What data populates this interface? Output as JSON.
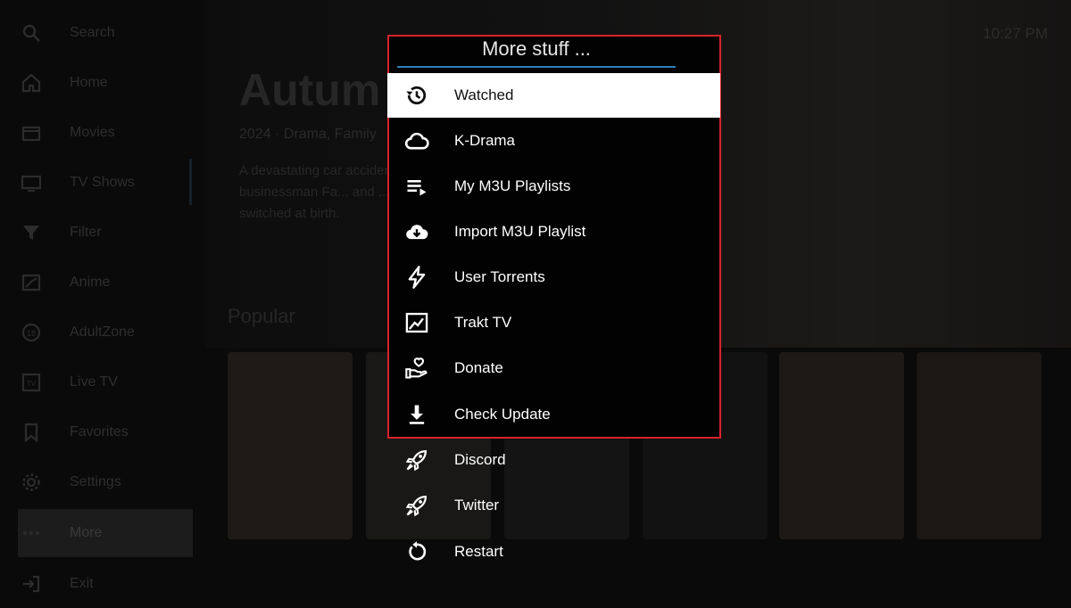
{
  "background": {
    "clock": "10:27 PM",
    "hero": {
      "title": "Autum",
      "meta": "2024 · Drama, Family",
      "description": "A devastating car accident unearths a long-buried secret that turns wealthy businessman Fa... and ...a life around fifteen years ago: their daughters were switched at birth."
    },
    "section_title": "Popular",
    "sidebar": {
      "items": [
        {
          "label": "Search",
          "icon": "search-icon"
        },
        {
          "label": "Home",
          "icon": "home-icon"
        },
        {
          "label": "Movies",
          "icon": "movie-icon"
        },
        {
          "label": "TV Shows",
          "icon": "tv-icon"
        },
        {
          "label": "Filter",
          "icon": "filter-icon"
        },
        {
          "label": "Anime",
          "icon": "anime-icon"
        },
        {
          "label": "AdultZone",
          "icon": "adult-icon"
        },
        {
          "label": "Live TV",
          "icon": "live-tv-icon"
        },
        {
          "label": "Favorites",
          "icon": "bookmark-icon"
        },
        {
          "label": "Settings",
          "icon": "gear-icon"
        },
        {
          "label": "More",
          "icon": "more-icon"
        },
        {
          "label": "Exit",
          "icon": "exit-icon"
        }
      ]
    }
  },
  "menu": {
    "title": "More stuff ...",
    "accent_color": "#d8232a",
    "underline_color": "#2d7fb8",
    "items": [
      {
        "label": "Watched",
        "icon": "history-icon",
        "selected": true
      },
      {
        "label": "K-Drama",
        "icon": "cloud-icon"
      },
      {
        "label": "My M3U Playlists",
        "icon": "playlist-icon"
      },
      {
        "label": "Import M3U Playlist",
        "icon": "cloud-download-icon"
      },
      {
        "label": "User Torrents",
        "icon": "lightning-icon"
      },
      {
        "label": "Trakt TV",
        "icon": "trakt-icon"
      },
      {
        "label": "Donate",
        "icon": "donate-heart-hand-icon"
      },
      {
        "label": "Check Update",
        "icon": "download-icon"
      },
      {
        "label": "Discord",
        "icon": "rocket-icon"
      },
      {
        "label": "Twitter",
        "icon": "rocket-icon"
      },
      {
        "label": "Restart",
        "icon": "restart-icon"
      }
    ]
  }
}
